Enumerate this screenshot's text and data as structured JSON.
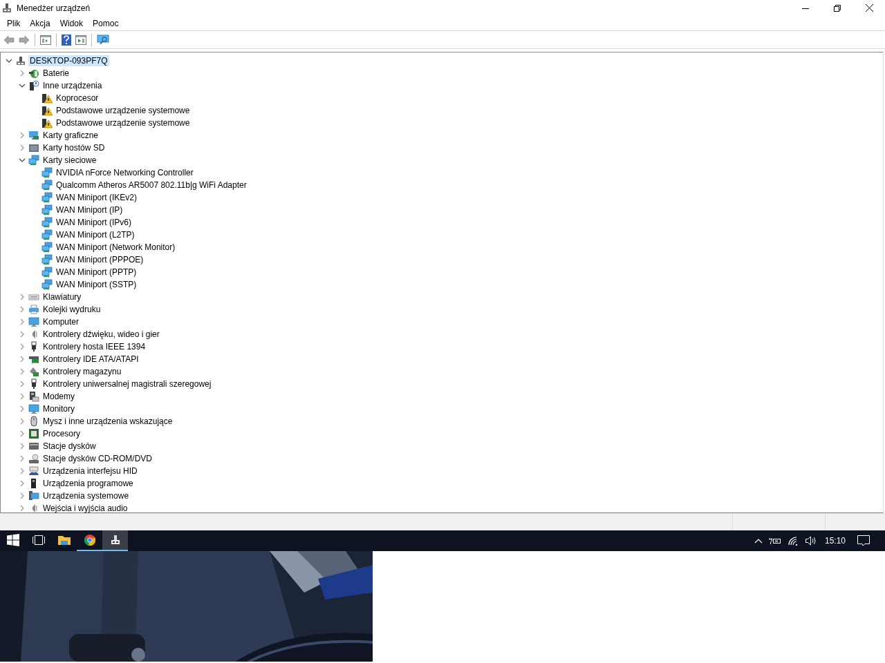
{
  "window": {
    "title": "Menedżer urządzeń"
  },
  "menu": [
    "Plik",
    "Akcja",
    "Widok",
    "Pomoc"
  ],
  "toolbar": [
    {
      "kind": "back",
      "disabled": true
    },
    {
      "kind": "forward",
      "disabled": true
    },
    {
      "kind": "sep"
    },
    {
      "kind": "properties"
    },
    {
      "kind": "sep"
    },
    {
      "kind": "help"
    },
    {
      "kind": "run"
    },
    {
      "kind": "sep"
    },
    {
      "kind": "scan"
    }
  ],
  "tree": [
    {
      "label": "DESKTOP-093PF7Q",
      "kind": "root",
      "selected": true,
      "expanded": true,
      "children": [
        {
          "label": "Baterie",
          "kind": "battery",
          "selected": false,
          "expanded": false
        },
        {
          "label": "Inne urządzenia",
          "kind": "unknown",
          "selected": false,
          "expanded": true,
          "children": [
            {
              "label": "Koprocesor",
              "kind": "warning",
              "selected": false
            },
            {
              "label": "Podstawowe urządzenie systemowe",
              "kind": "warning",
              "selected": false
            },
            {
              "label": "Podstawowe urządzenie systemowe",
              "kind": "warning",
              "selected": false
            }
          ]
        },
        {
          "label": "Karty graficzne",
          "kind": "display",
          "selected": false,
          "expanded": false
        },
        {
          "label": "Karty hostów SD",
          "kind": "sd",
          "selected": false,
          "expanded": false
        },
        {
          "label": "Karty sieciowe",
          "kind": "network",
          "selected": false,
          "expanded": true,
          "children": [
            {
              "label": "NVIDIA nForce Networking Controller",
              "kind": "network",
              "selected": false
            },
            {
              "label": "Qualcomm Atheros AR5007 802.11b|g WiFi Adapter",
              "kind": "network",
              "selected": false
            },
            {
              "label": "WAN Miniport (IKEv2)",
              "kind": "network",
              "selected": false
            },
            {
              "label": "WAN Miniport (IP)",
              "kind": "network",
              "selected": false
            },
            {
              "label": "WAN Miniport (IPv6)",
              "kind": "network",
              "selected": false
            },
            {
              "label": "WAN Miniport (L2TP)",
              "kind": "network",
              "selected": false
            },
            {
              "label": "WAN Miniport (Network Monitor)",
              "kind": "network",
              "selected": false
            },
            {
              "label": "WAN Miniport (PPPOE)",
              "kind": "network",
              "selected": false
            },
            {
              "label": "WAN Miniport (PPTP)",
              "kind": "network",
              "selected": false
            },
            {
              "label": "WAN Miniport (SSTP)",
              "kind": "network",
              "selected": false
            }
          ]
        },
        {
          "label": "Klawiatury",
          "kind": "keyboard",
          "selected": false,
          "expanded": false
        },
        {
          "label": "Kolejki wydruku",
          "kind": "printer",
          "selected": false,
          "expanded": false
        },
        {
          "label": "Komputer",
          "kind": "monitor",
          "selected": false,
          "expanded": false
        },
        {
          "label": "Kontrolery dźwięku, wideo i gier",
          "kind": "sound",
          "selected": false,
          "expanded": false
        },
        {
          "label": "Kontrolery hosta IEEE 1394",
          "kind": "plug",
          "selected": false,
          "expanded": false
        },
        {
          "label": "Kontrolery IDE ATA/ATAPI",
          "kind": "ide",
          "selected": false,
          "expanded": false
        },
        {
          "label": "Kontrolery magazynu",
          "kind": "storage",
          "selected": false,
          "expanded": false
        },
        {
          "label": "Kontrolery uniwersalnej magistrali szeregowej",
          "kind": "plug",
          "selected": false,
          "expanded": false
        },
        {
          "label": "Modemy",
          "kind": "modem",
          "selected": false,
          "expanded": false
        },
        {
          "label": "Monitory",
          "kind": "monitor",
          "selected": false,
          "expanded": false
        },
        {
          "label": "Mysz i inne urządzenia wskazujące",
          "kind": "mouse",
          "selected": false,
          "expanded": false
        },
        {
          "label": "Procesory",
          "kind": "cpu",
          "selected": false,
          "expanded": false
        },
        {
          "label": "Stacje dysków",
          "kind": "disk",
          "selected": false,
          "expanded": false
        },
        {
          "label": "Stacje dysków CD-ROM/DVD",
          "kind": "cdrom",
          "selected": false,
          "expanded": false
        },
        {
          "label": "Urządzenia interfejsu HID",
          "kind": "hid",
          "selected": false,
          "expanded": false
        },
        {
          "label": "Urządzenia programowe",
          "kind": "software",
          "selected": false,
          "expanded": false
        },
        {
          "label": "Urządzenia systemowe",
          "kind": "system",
          "selected": false,
          "expanded": false
        },
        {
          "label": "Wejścia i wyjścia audio",
          "kind": "sound",
          "selected": false,
          "expanded": false
        }
      ]
    }
  ],
  "taskbar": {
    "buttons": [
      {
        "kind": "start",
        "open": false,
        "selected": false
      },
      {
        "kind": "taskview",
        "open": false,
        "selected": false
      },
      {
        "kind": "explorer",
        "open": false,
        "selected": false
      },
      {
        "kind": "browser",
        "open": true,
        "selected": false
      },
      {
        "kind": "devmgr",
        "open": true,
        "selected": true
      }
    ],
    "clock": "15:10"
  },
  "background": {
    "kind": "picture"
  }
}
